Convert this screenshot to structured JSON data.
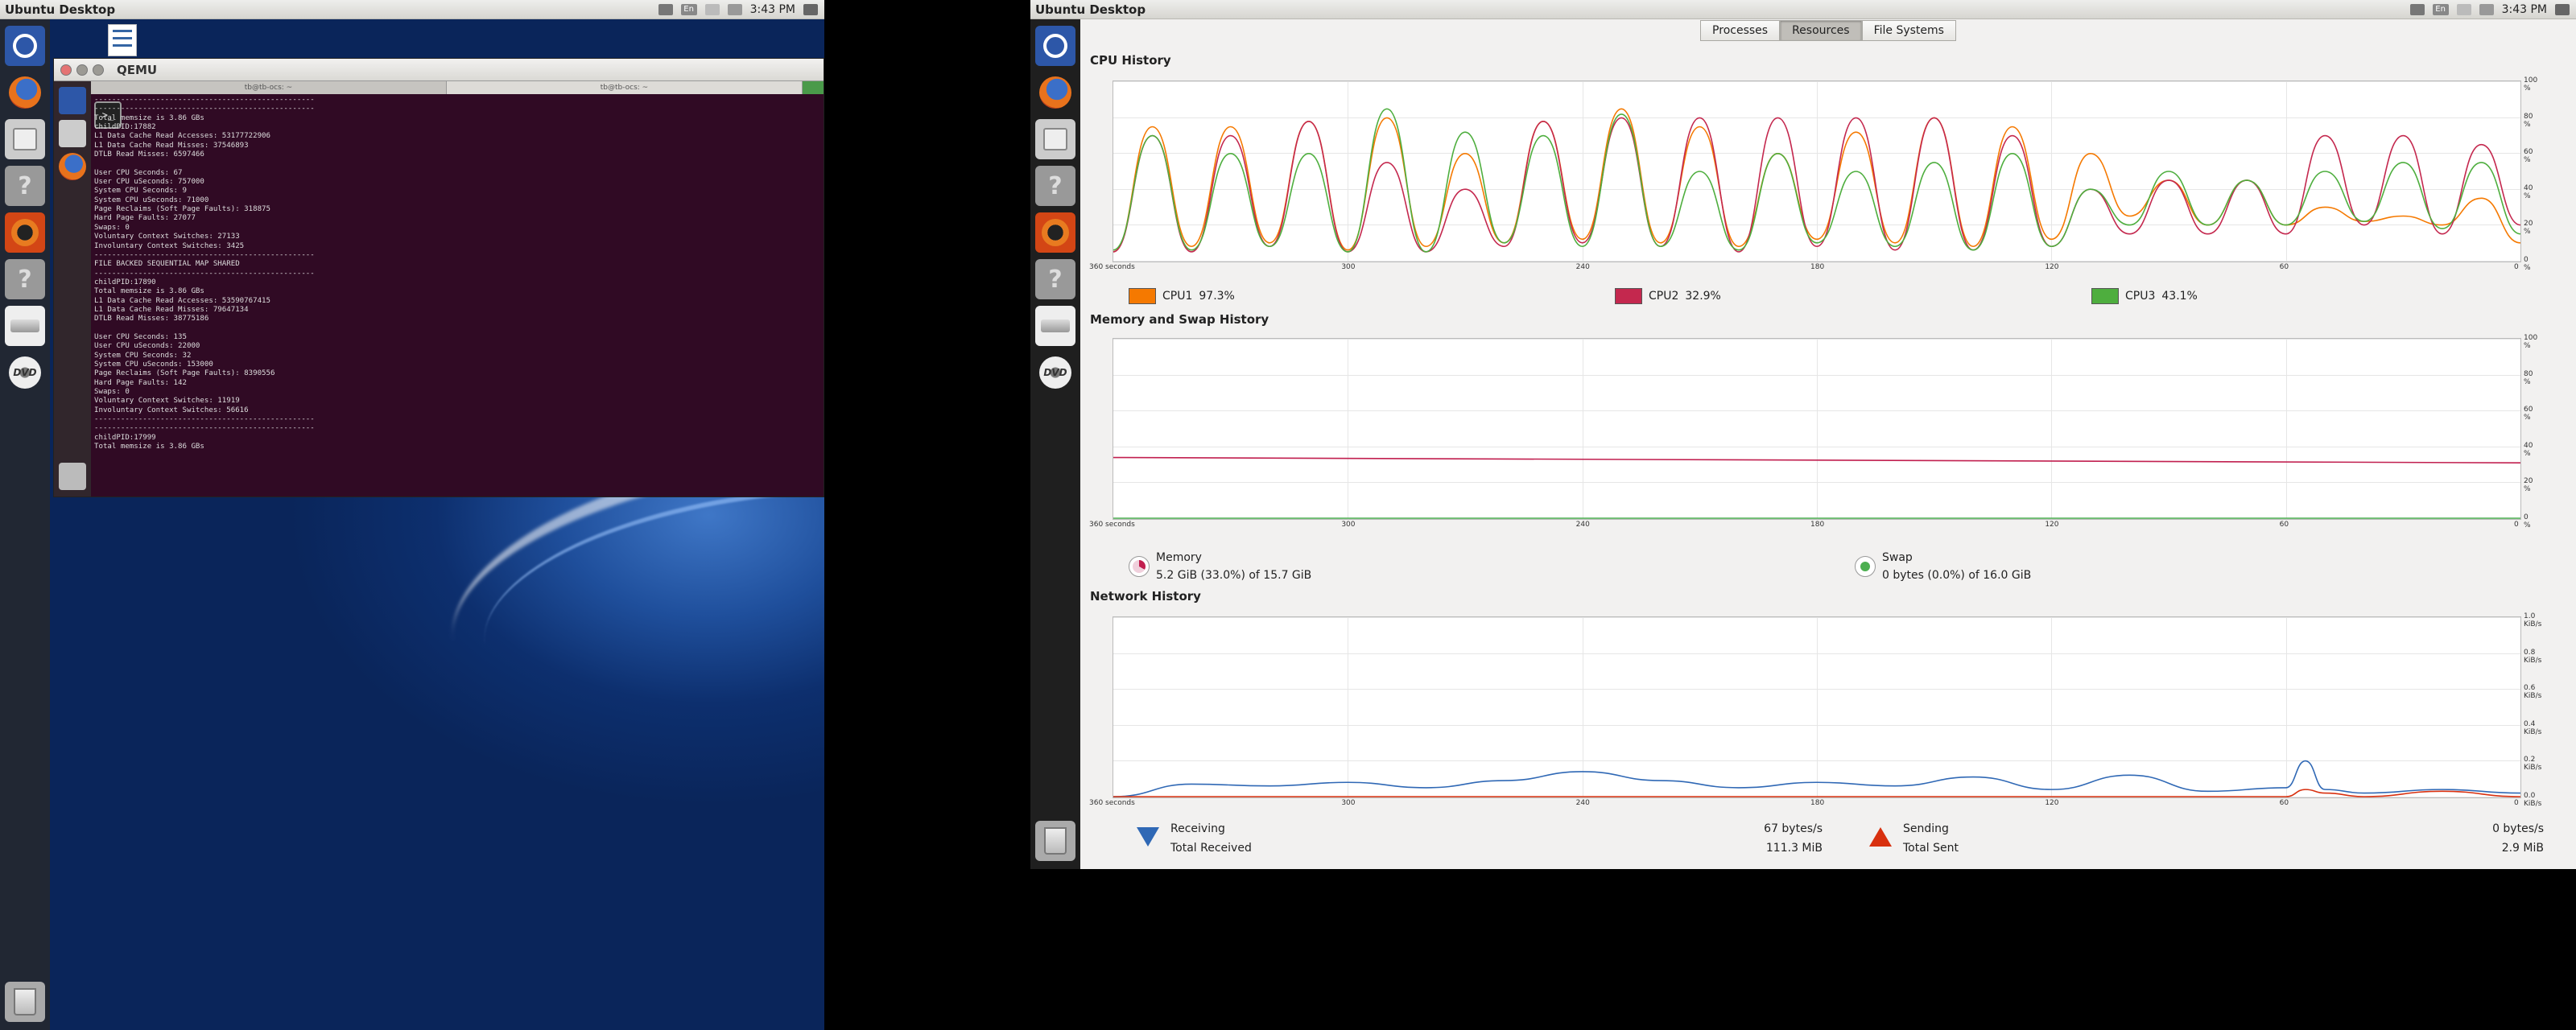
{
  "screen1": {
    "topbar": {
      "title": "Ubuntu Desktop",
      "lang": "En",
      "clock": "3:43 PM"
    },
    "qemu": {
      "title": "QEMU",
      "tabs": [
        "tb@tb-ocs: ~",
        "tb@tb-ocs: ~"
      ],
      "terminal_lines": [
        "--------------------------------------------------",
        "--------------------------------------------------",
        "Total memsize is 3.86 GBs",
        "childPID:17882",
        "L1 Data Cache Read Accesses: 53177722906",
        "L1 Data Cache Read Misses: 37546893",
        "DTLB Read Misses: 6597466",
        "",
        "User CPU Seconds: 67",
        "User CPU uSeconds: 757000",
        "System CPU Seconds: 9",
        "System CPU uSeconds: 71000",
        "Page Reclaims (Soft Page Faults): 318875",
        "Hard Page Faults: 27077",
        "Swaps: 0",
        "Voluntary Context Switches: 27133",
        "Involuntary Context Switches: 3425",
        "--------------------------------------------------",
        "FILE BACKED SEQUENTIAL MAP SHARED",
        "--------------------------------------------------",
        "childPID:17890",
        "Total memsize is 3.86 GBs",
        "L1 Data Cache Read Accesses: 53590767415",
        "L1 Data Cache Read Misses: 79647134",
        "DTLB Read Misses: 38775186",
        "",
        "User CPU Seconds: 135",
        "User CPU uSeconds: 22000",
        "System CPU Seconds: 32",
        "System CPU uSeconds: 153000",
        "Page Reclaims (Soft Page Faults): 8390556",
        "Hard Page Faults: 142",
        "Swaps: 0",
        "Voluntary Context Switches: 11919",
        "Involuntary Context Switches: 56616",
        "--------------------------------------------------",
        "--------------------------------------------------",
        "childPID:17999",
        "Total memsize is 3.86 GBs"
      ]
    }
  },
  "screen2": {
    "topbar": {
      "title": "Ubuntu Desktop",
      "lang": "En",
      "clock": "3:43 PM"
    },
    "tabs": [
      "Processes",
      "Resources",
      "File Systems"
    ],
    "active_tab": "Resources",
    "sections": {
      "cpu": "CPU History",
      "mem": "Memory and Swap History",
      "net": "Network History"
    },
    "x_ticks": [
      "360 seconds",
      "300",
      "240",
      "180",
      "120",
      "60",
      "0"
    ],
    "pct_ticks": [
      "100 %",
      "80 %",
      "60 %",
      "40 %",
      "20 %",
      "0 %"
    ],
    "net_ticks": [
      "1.0 KiB/s",
      "0.8 KiB/s",
      "0.6 KiB/s",
      "0.4 KiB/s",
      "0.2 KiB/s",
      "0.0 KiB/s"
    ],
    "cpu_legend": [
      {
        "name": "CPU1",
        "value": "97.3%",
        "color": "#f57900"
      },
      {
        "name": "CPU2",
        "value": "32.9%",
        "color": "#c4284e"
      },
      {
        "name": "CPU3",
        "value": "43.1%",
        "color": "#4eae3e"
      }
    ],
    "memory": {
      "label": "Memory",
      "detail": "5.2 GiB (33.0%) of 15.7 GiB",
      "color": "#c11f4f"
    },
    "swap": {
      "label": "Swap",
      "detail": "0 bytes (0.0%) of 16.0 GiB",
      "color": "#4caf50"
    },
    "network": {
      "receiving_label": "Receiving",
      "receiving_value": "67 bytes/s",
      "total_received_label": "Total Received",
      "total_received_value": "111.3 MiB",
      "sending_label": "Sending",
      "sending_value": "0 bytes/s",
      "total_sent_label": "Total Sent",
      "total_sent_value": "2.9 MiB",
      "recv_color": "#2f68b5",
      "send_color": "#d8300f"
    }
  },
  "chart_data": [
    {
      "type": "line",
      "title": "CPU History",
      "x": [
        360,
        350,
        340,
        330,
        320,
        310,
        300,
        290,
        280,
        270,
        260,
        250,
        240,
        230,
        220,
        210,
        200,
        190,
        180,
        170,
        160,
        150,
        140,
        130,
        120,
        110,
        100,
        90,
        80,
        70,
        60,
        50,
        40,
        30,
        20,
        10,
        0
      ],
      "ylim": [
        0,
        100
      ],
      "series": [
        {
          "name": "CPU1",
          "values": [
            5,
            75,
            8,
            75,
            10,
            78,
            6,
            80,
            8,
            60,
            10,
            78,
            12,
            85,
            10,
            75,
            8,
            60,
            12,
            72,
            10,
            80,
            8,
            75,
            12,
            60,
            25,
            45,
            20,
            45,
            20,
            30,
            22,
            25,
            20,
            35,
            10
          ]
        },
        {
          "name": "CPU2",
          "values": [
            5,
            70,
            5,
            70,
            8,
            78,
            5,
            55,
            5,
            40,
            8,
            78,
            10,
            80,
            8,
            80,
            5,
            80,
            8,
            80,
            6,
            80,
            6,
            70,
            8,
            40,
            15,
            45,
            15,
            45,
            15,
            70,
            20,
            70,
            15,
            65,
            20
          ]
        },
        {
          "name": "CPU3",
          "values": [
            6,
            70,
            6,
            60,
            8,
            60,
            5,
            85,
            5,
            72,
            10,
            70,
            8,
            82,
            8,
            50,
            6,
            60,
            10,
            50,
            8,
            55,
            6,
            60,
            8,
            40,
            20,
            50,
            20,
            45,
            20,
            50,
            22,
            55,
            18,
            55,
            15
          ]
        }
      ]
    },
    {
      "type": "line",
      "title": "Memory and Swap History",
      "x": [
        360,
        0
      ],
      "ylim": [
        0,
        100
      ],
      "series": [
        {
          "name": "Memory",
          "values": [
            34,
            31
          ]
        },
        {
          "name": "Swap",
          "values": [
            0,
            0
          ]
        }
      ]
    },
    {
      "type": "line",
      "title": "Network History",
      "x": [
        360,
        340,
        320,
        300,
        280,
        260,
        240,
        220,
        200,
        180,
        160,
        140,
        120,
        100,
        80,
        60,
        55,
        50,
        40,
        20,
        0
      ],
      "ylim": [
        0,
        1.0
      ],
      "series": [
        {
          "name": "Receiving",
          "values": [
            0.0,
            0.07,
            0.06,
            0.08,
            0.05,
            0.09,
            0.14,
            0.09,
            0.05,
            0.08,
            0.06,
            0.11,
            0.04,
            0.12,
            0.03,
            0.05,
            0.2,
            0.04,
            0.02,
            0.04,
            0.02
          ]
        },
        {
          "name": "Sending",
          "values": [
            0,
            0,
            0,
            0,
            0,
            0,
            0,
            0,
            0,
            0,
            0,
            0,
            0,
            0,
            0,
            0,
            0.04,
            0.02,
            0,
            0.03,
            0
          ]
        }
      ]
    }
  ]
}
